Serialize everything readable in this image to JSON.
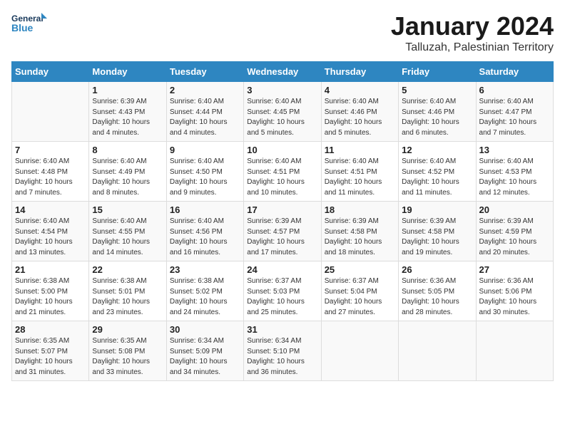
{
  "logo": {
    "line1": "General",
    "line2": "Blue"
  },
  "title": "January 2024",
  "subtitle": "Talluzah, Palestinian Territory",
  "days_of_week": [
    "Sunday",
    "Monday",
    "Tuesday",
    "Wednesday",
    "Thursday",
    "Friday",
    "Saturday"
  ],
  "weeks": [
    [
      {
        "day": "",
        "info": ""
      },
      {
        "day": "1",
        "info": "Sunrise: 6:39 AM\nSunset: 4:43 PM\nDaylight: 10 hours\nand 4 minutes."
      },
      {
        "day": "2",
        "info": "Sunrise: 6:40 AM\nSunset: 4:44 PM\nDaylight: 10 hours\nand 4 minutes."
      },
      {
        "day": "3",
        "info": "Sunrise: 6:40 AM\nSunset: 4:45 PM\nDaylight: 10 hours\nand 5 minutes."
      },
      {
        "day": "4",
        "info": "Sunrise: 6:40 AM\nSunset: 4:46 PM\nDaylight: 10 hours\nand 5 minutes."
      },
      {
        "day": "5",
        "info": "Sunrise: 6:40 AM\nSunset: 4:46 PM\nDaylight: 10 hours\nand 6 minutes."
      },
      {
        "day": "6",
        "info": "Sunrise: 6:40 AM\nSunset: 4:47 PM\nDaylight: 10 hours\nand 7 minutes."
      }
    ],
    [
      {
        "day": "7",
        "info": "Sunrise: 6:40 AM\nSunset: 4:48 PM\nDaylight: 10 hours\nand 7 minutes."
      },
      {
        "day": "8",
        "info": "Sunrise: 6:40 AM\nSunset: 4:49 PM\nDaylight: 10 hours\nand 8 minutes."
      },
      {
        "day": "9",
        "info": "Sunrise: 6:40 AM\nSunset: 4:50 PM\nDaylight: 10 hours\nand 9 minutes."
      },
      {
        "day": "10",
        "info": "Sunrise: 6:40 AM\nSunset: 4:51 PM\nDaylight: 10 hours\nand 10 minutes."
      },
      {
        "day": "11",
        "info": "Sunrise: 6:40 AM\nSunset: 4:51 PM\nDaylight: 10 hours\nand 11 minutes."
      },
      {
        "day": "12",
        "info": "Sunrise: 6:40 AM\nSunset: 4:52 PM\nDaylight: 10 hours\nand 11 minutes."
      },
      {
        "day": "13",
        "info": "Sunrise: 6:40 AM\nSunset: 4:53 PM\nDaylight: 10 hours\nand 12 minutes."
      }
    ],
    [
      {
        "day": "14",
        "info": "Sunrise: 6:40 AM\nSunset: 4:54 PM\nDaylight: 10 hours\nand 13 minutes."
      },
      {
        "day": "15",
        "info": "Sunrise: 6:40 AM\nSunset: 4:55 PM\nDaylight: 10 hours\nand 14 minutes."
      },
      {
        "day": "16",
        "info": "Sunrise: 6:40 AM\nSunset: 4:56 PM\nDaylight: 10 hours\nand 16 minutes."
      },
      {
        "day": "17",
        "info": "Sunrise: 6:39 AM\nSunset: 4:57 PM\nDaylight: 10 hours\nand 17 minutes."
      },
      {
        "day": "18",
        "info": "Sunrise: 6:39 AM\nSunset: 4:58 PM\nDaylight: 10 hours\nand 18 minutes."
      },
      {
        "day": "19",
        "info": "Sunrise: 6:39 AM\nSunset: 4:58 PM\nDaylight: 10 hours\nand 19 minutes."
      },
      {
        "day": "20",
        "info": "Sunrise: 6:39 AM\nSunset: 4:59 PM\nDaylight: 10 hours\nand 20 minutes."
      }
    ],
    [
      {
        "day": "21",
        "info": "Sunrise: 6:38 AM\nSunset: 5:00 PM\nDaylight: 10 hours\nand 21 minutes."
      },
      {
        "day": "22",
        "info": "Sunrise: 6:38 AM\nSunset: 5:01 PM\nDaylight: 10 hours\nand 23 minutes."
      },
      {
        "day": "23",
        "info": "Sunrise: 6:38 AM\nSunset: 5:02 PM\nDaylight: 10 hours\nand 24 minutes."
      },
      {
        "day": "24",
        "info": "Sunrise: 6:37 AM\nSunset: 5:03 PM\nDaylight: 10 hours\nand 25 minutes."
      },
      {
        "day": "25",
        "info": "Sunrise: 6:37 AM\nSunset: 5:04 PM\nDaylight: 10 hours\nand 27 minutes."
      },
      {
        "day": "26",
        "info": "Sunrise: 6:36 AM\nSunset: 5:05 PM\nDaylight: 10 hours\nand 28 minutes."
      },
      {
        "day": "27",
        "info": "Sunrise: 6:36 AM\nSunset: 5:06 PM\nDaylight: 10 hours\nand 30 minutes."
      }
    ],
    [
      {
        "day": "28",
        "info": "Sunrise: 6:35 AM\nSunset: 5:07 PM\nDaylight: 10 hours\nand 31 minutes."
      },
      {
        "day": "29",
        "info": "Sunrise: 6:35 AM\nSunset: 5:08 PM\nDaylight: 10 hours\nand 33 minutes."
      },
      {
        "day": "30",
        "info": "Sunrise: 6:34 AM\nSunset: 5:09 PM\nDaylight: 10 hours\nand 34 minutes."
      },
      {
        "day": "31",
        "info": "Sunrise: 6:34 AM\nSunset: 5:10 PM\nDaylight: 10 hours\nand 36 minutes."
      },
      {
        "day": "",
        "info": ""
      },
      {
        "day": "",
        "info": ""
      },
      {
        "day": "",
        "info": ""
      }
    ]
  ]
}
